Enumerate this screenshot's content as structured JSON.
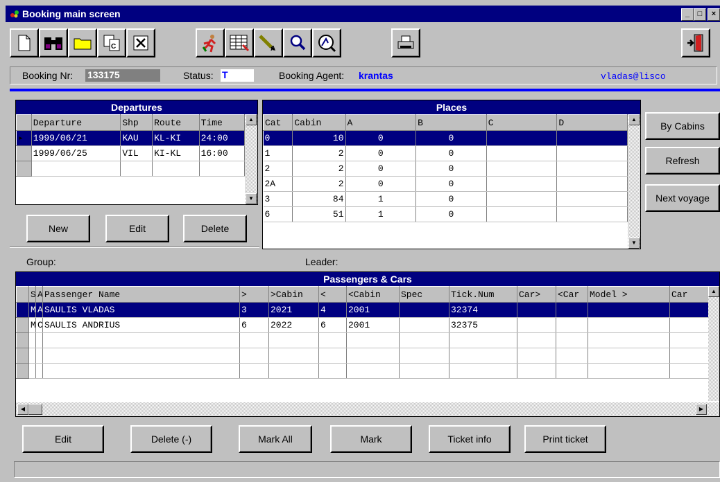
{
  "window": {
    "title": "Booking main screen"
  },
  "info": {
    "booking_nr_label": "Booking Nr:",
    "booking_nr": "133175",
    "status_label": "Status:",
    "status": "T",
    "agent_label": "Booking Agent:",
    "agent": "krantas",
    "user": "vladas@lisco"
  },
  "departures": {
    "title": "Departures",
    "columns": [
      "Departure",
      "Shp",
      "Route",
      "Time"
    ],
    "rows": [
      [
        "1999/06/21",
        "KAU",
        "KL-KI",
        "24:00"
      ],
      [
        "1999/06/25",
        "VIL",
        "KI-KL",
        "16:00"
      ]
    ],
    "buttons": {
      "new": "New",
      "edit": "Edit",
      "delete": "Delete"
    }
  },
  "places": {
    "title": "Places",
    "columns": [
      "Cat",
      "Cabin",
      "A",
      "B",
      "C",
      "D"
    ],
    "rows": [
      [
        "0",
        "10",
        "0",
        "0",
        "",
        ""
      ],
      [
        "1",
        "2",
        "0",
        "0",
        "",
        ""
      ],
      [
        "2",
        "2",
        "0",
        "0",
        "",
        ""
      ],
      [
        "2A",
        "2",
        "0",
        "0",
        "",
        ""
      ],
      [
        "3",
        "84",
        "1",
        "0",
        "",
        ""
      ],
      [
        "6",
        "51",
        "1",
        "0",
        "",
        ""
      ]
    ]
  },
  "side_buttons": {
    "by_cabins": "By Cabins",
    "refresh": "Refresh",
    "next_voyage": "Next voyage"
  },
  "group_label": "Group:",
  "leader_label": "Leader:",
  "passengers": {
    "title": "Passengers & Cars",
    "columns": [
      "S",
      "A",
      "Passenger Name",
      ">",
      ">Cabin",
      "<",
      "<Cabin",
      "Spec",
      "Tick.Num",
      "Car>",
      "<Car",
      "Model >",
      "Car"
    ],
    "rows": [
      [
        "M",
        "A",
        "SAULIS VLADAS",
        "3",
        "2021",
        "4",
        "2001",
        "",
        "32374",
        "",
        "",
        "",
        ""
      ],
      [
        "M",
        "C",
        "SAULIS ANDRIUS",
        "6",
        "2022",
        "6",
        "2001",
        "",
        "32375",
        "",
        "",
        "",
        ""
      ]
    ]
  },
  "bottom_buttons": {
    "edit": "Edit",
    "delete": "Delete (-)",
    "mark_all": "Mark All",
    "mark": "Mark",
    "ticket_info": "Ticket info",
    "print_ticket": "Print ticket"
  }
}
